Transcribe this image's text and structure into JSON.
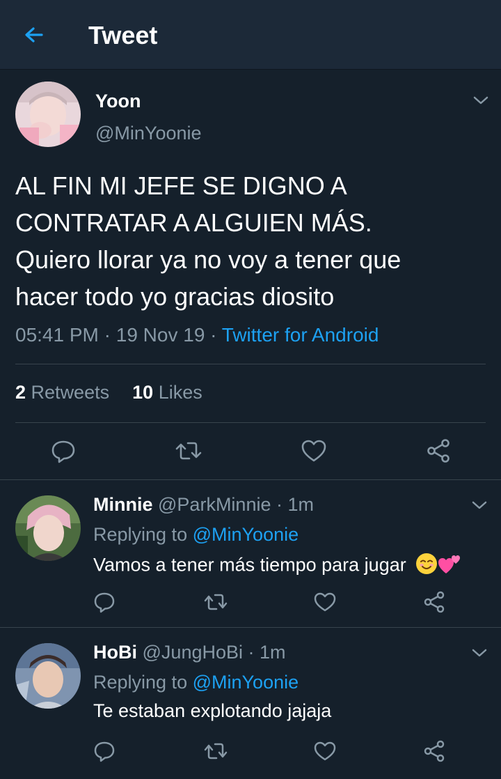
{
  "header": {
    "title": "Tweet"
  },
  "tweet": {
    "author_name": "Yoon",
    "author_handle": "@MinYoonie",
    "text_lines": [
      "AL FIN MI JEFE SE DIGNO A",
      "CONTRATAR A ALGUIEN MÁS.",
      "Quiero llorar ya no voy a tener que",
      "hacer todo yo gracias diosito"
    ],
    "time": "05:41 PM",
    "date": "19 Nov 19",
    "source": "Twitter for Android",
    "retweet_count": "2",
    "retweet_label": "Retweets",
    "like_count": "10",
    "like_label": "Likes"
  },
  "replies": [
    {
      "name": "Minnie",
      "handle": "@ParkMinnie",
      "time": "1m",
      "replying_label": "Replying to",
      "replying_to": "@MinYoonie",
      "text": "Vamos a tener más tiempo para jugar",
      "emojis": [
        "smiling-face-icon",
        "two-hearts-icon"
      ]
    },
    {
      "name": "HoBi",
      "handle": "@JungHoBi",
      "time": "1m",
      "replying_label": "Replying to",
      "replying_to": "@MinYoonie",
      "text": "Te estaban explotando jajaja"
    }
  ],
  "colors": {
    "background": "#15202b",
    "header": "#1c2938",
    "accent": "#1da1f2",
    "secondary_text": "#8899a6",
    "divider": "#38444d"
  },
  "icons": [
    "back-arrow-icon",
    "chevron-down-icon",
    "reply-icon",
    "retweet-icon",
    "like-icon",
    "share-icon"
  ]
}
